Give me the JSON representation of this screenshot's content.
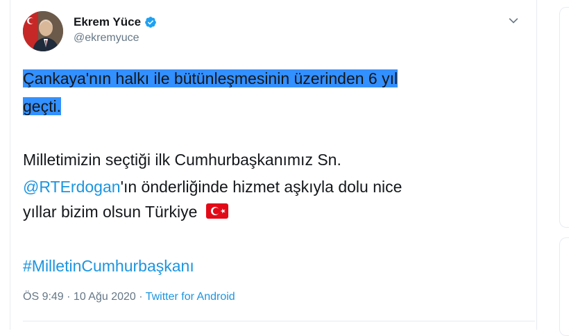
{
  "author": {
    "name": "Ekrem Yüce",
    "handle": "@ekremyuce"
  },
  "tweet": {
    "selected_line_1": "Çankaya'nın halkı ile bütünleşmesinin üzerinden 6 yıl",
    "selected_line_2": "geçti.",
    "line_3": "Milletimizin seçtiği ilk Cumhurbaşkanımız Sn.",
    "mention": "@RTErdogan",
    "line_4_rest": "'ın önderliğinde hizmet aşkıyla dolu nice",
    "line_5": "yıllar bizim olsun Türkiye",
    "hashtag": "#MilletinCumhurbaşkanı"
  },
  "meta": {
    "time": "ÖS 9:49",
    "sep1": " · ",
    "date": "10 Ağu 2020",
    "sep2": " · ",
    "source": "Twitter for Android"
  },
  "colors": {
    "link": "#1b95e0",
    "selection": "#3390ff",
    "secondary_text": "#657786",
    "verified": "#1da1f2",
    "flag_red": "#e30a17"
  },
  "icons": [
    "verified-badge-icon",
    "chevron-down-icon",
    "turkey-flag-emoji"
  ]
}
